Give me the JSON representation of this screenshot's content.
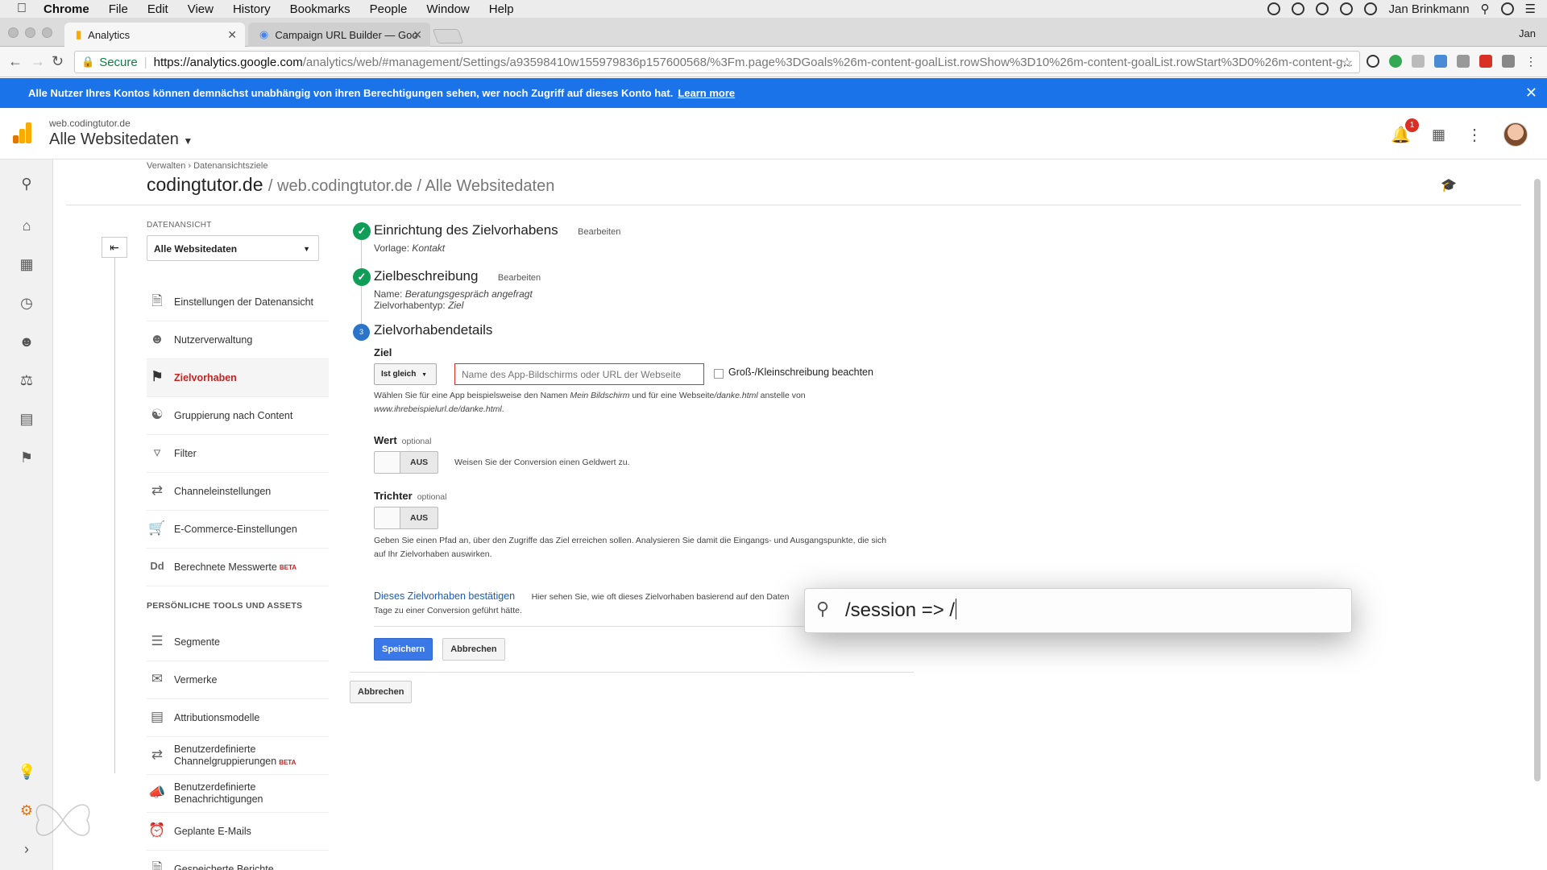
{
  "menubar": {
    "apple": "",
    "items": [
      "Chrome",
      "File",
      "Edit",
      "View",
      "History",
      "Bookmarks",
      "People",
      "Window",
      "Help"
    ],
    "user": "Jan Brinkmann"
  },
  "tabs": [
    {
      "title": "Analytics",
      "active": true
    },
    {
      "title": "Campaign URL Builder — Goo",
      "active": false
    }
  ],
  "profile": "Jan",
  "address": {
    "secure_label": "Secure",
    "host": "https://analytics.google.com",
    "path": "/analytics/web/#management/Settings/a93598410w155979836p157600568/%3Fm.page%3DGoals%26m-content-goalList.rowShow%3D10%26m-content-goalList.rowStart%3D0%26m-content-g..."
  },
  "banner": {
    "text": "Alle Nutzer Ihres Kontos können demnächst unabhängig von ihren Berechtigungen sehen, wer noch Zugriff auf dieses Konto hat.",
    "link": "Learn more",
    "color": "#1a73e8"
  },
  "header": {
    "account": "web.codingtutor.de",
    "view": "Alle Websitedaten",
    "notifications": "1"
  },
  "breadcrumb": [
    "Verwalten",
    "›",
    "Datenansichtsziele"
  ],
  "title": {
    "main": "codingtutor.de",
    "sub": "/ web.codingtutor.de / Alle Websitedaten"
  },
  "view_panel": {
    "label": "DATENANSICHT",
    "selected": "Alle Websitedaten",
    "items": [
      {
        "label": "Einstellungen der Datenansicht",
        "icon": "document-icon"
      },
      {
        "label": "Nutzerverwaltung",
        "icon": "users-icon"
      },
      {
        "label": "Zielvorhaben",
        "icon": "flag-icon",
        "active": true
      },
      {
        "label": "Gruppierung nach Content",
        "icon": "grouping-icon"
      },
      {
        "label": "Filter",
        "icon": "filter-icon"
      },
      {
        "label": "Channeleinstellungen",
        "icon": "channel-icon"
      },
      {
        "label": "E-Commerce-Einstellungen",
        "icon": "cart-icon"
      },
      {
        "label": "Berechnete Messwerte",
        "icon": "calc-icon",
        "beta": "BETA"
      }
    ],
    "tools_heading": "PERSÖNLICHE TOOLS UND ASSETS",
    "tools": [
      {
        "label": "Segmente",
        "icon": "segments-icon"
      },
      {
        "label": "Vermerke",
        "icon": "annotation-icon"
      },
      {
        "label": "Attributionsmodelle",
        "icon": "bar-chart-icon"
      },
      {
        "label": "Benutzerdefinierte Channelgruppierungen",
        "icon": "channel-group-icon",
        "beta": "BETA"
      },
      {
        "label": "Benutzerdefinierte Benachrichtigungen",
        "icon": "megaphone-icon"
      },
      {
        "label": "Geplante E-Mails",
        "icon": "clock-mail-icon"
      },
      {
        "label": "Gespeicherte Berichte",
        "icon": "saved-report-icon"
      }
    ]
  },
  "goal": {
    "step1": {
      "title": "Einrichtung des Zielvorhabens",
      "edit": "Bearbeiten",
      "sub_label": "Vorlage:",
      "sub_value": "Kontakt"
    },
    "step2": {
      "title": "Zielbeschreibung",
      "edit": "Bearbeiten",
      "name_label": "Name:",
      "name_value": "Beratungsgespräch angefragt",
      "type_label": "Zielvorhabentyp:",
      "type_value": "Ziel"
    },
    "step3": {
      "number": "3",
      "title": "Zielvorhabendetails"
    },
    "ziel_label": "Ziel",
    "match_type": "Ist gleich",
    "input_placeholder": "Name des App-Bildschirms oder URL der Webseite",
    "case_label": "Groß-/Kleinschreibung beachten",
    "help1": "Wählen Sie für eine App beispielsweise den Namen",
    "help1_i1": "Mein Bildschirm",
    "help1_mid": "und für eine Webseite",
    "help1_i2": "/danke.html",
    "help1_end": "anstelle von",
    "help1_i3": "www.ihrebeispielurl.de/danke.html",
    "help1_dot": ".",
    "wert_label": "Wert",
    "optional": "optional",
    "toggle_off": "AUS",
    "wert_help": "Weisen Sie der Conversion einen Geldwert zu.",
    "trichter_label": "Trichter",
    "trichter_help": "Geben Sie einen Pfad an, über den Zugriffe das Ziel erreichen sollen. Analysieren Sie damit die Eingangs- und Ausgangspunkte, die sich auf Ihr Zielvorhaben auswirken.",
    "verify_link": "Dieses Zielvorhaben bestätigen",
    "verify_help_1": "Hier sehen Sie, wie oft dieses Zielvorhaben basierend auf den Daten",
    "verify_help_2": "Tage zu einer Conversion geführt hätte.",
    "save": "Speichern",
    "cancel": "Abbrechen",
    "cancel_outer": "Abbrechen"
  },
  "spotlight": {
    "query": "/session => /"
  }
}
